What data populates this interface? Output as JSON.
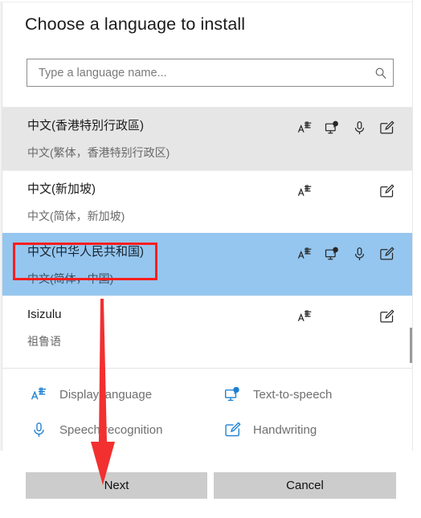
{
  "header": {
    "title": "Choose a language to install"
  },
  "search": {
    "name": "search-input",
    "value": "",
    "placeholder": "Type a language name...",
    "icon": "search-icon"
  },
  "list": {
    "rows": [
      {
        "name": "中文(香港特別行政區)",
        "sub": "中文(繁体，香港特别行政区)",
        "state": "hover",
        "capabilities": [
          "display-language",
          "text-to-speech",
          "speech-recognition",
          "handwriting"
        ]
      },
      {
        "name": "中文(新加坡)",
        "sub": "中文(简体，新加坡)",
        "state": "normal",
        "capabilities": [
          "display-language",
          "handwriting"
        ]
      },
      {
        "name": "中文(中华人民共和国)",
        "sub": "中文(简体，中国)",
        "state": "selected",
        "capabilities": [
          "display-language",
          "text-to-speech",
          "speech-recognition",
          "handwriting"
        ]
      },
      {
        "name": "Isizulu",
        "sub": "祖鲁语",
        "state": "normal",
        "capabilities": [
          "display-language",
          "handwriting"
        ]
      }
    ]
  },
  "legend": {
    "items": [
      {
        "icon": "display-language-icon",
        "label": "Display language"
      },
      {
        "icon": "text-to-speech-icon",
        "label": "Text-to-speech"
      },
      {
        "icon": "speech-recognition-icon",
        "label": "Speech recognition"
      },
      {
        "icon": "handwriting-icon",
        "label": "Handwriting"
      }
    ]
  },
  "footer": {
    "next_label": "Next",
    "cancel_label": "Cancel"
  },
  "annotations": {
    "highlight_box_color": "#fb1e1e",
    "arrow_color": "#f23030",
    "arrow_target": "Next"
  },
  "colors": {
    "selected_row": "#95c6ef",
    "hover_row": "#e6e6e6",
    "icon_blue": "#1d7fd1",
    "button_gray": "#cccccc",
    "title_text": "#1b1b1b",
    "sub_text": "#696969"
  }
}
